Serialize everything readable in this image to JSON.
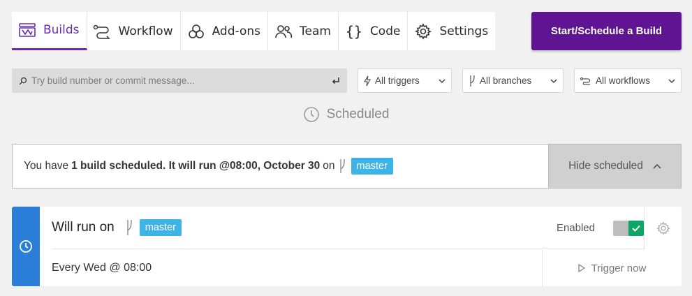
{
  "tabs": [
    {
      "label": "Builds",
      "icon": "builds-icon",
      "active": true
    },
    {
      "label": "Workflow",
      "icon": "workflow-icon"
    },
    {
      "label": "Add-ons",
      "icon": "addons-icon"
    },
    {
      "label": "Team",
      "icon": "team-icon"
    },
    {
      "label": "Code",
      "icon": "code-braces-icon"
    },
    {
      "label": "Settings",
      "icon": "gear-icon"
    }
  ],
  "start_button": "Start/Schedule a Build",
  "search": {
    "placeholder": "Try build number or commit message...",
    "value": ""
  },
  "filters": {
    "triggers": "All triggers",
    "branches": "All branches",
    "workflows": "All workflows"
  },
  "scheduled_heading": "Scheduled",
  "banner": {
    "prefix": "You have",
    "bold": "1 build scheduled. It will run @08:00, October 30",
    "on": "on",
    "branch": "master",
    "hide_label": "Hide scheduled"
  },
  "schedule_card": {
    "title": "Will run on",
    "branch": "master",
    "enabled_label": "Enabled",
    "enabled": true,
    "recurrence": "Every Wed @ 08:00",
    "trigger_label": "Trigger now"
  },
  "colors": {
    "accent": "#6a2ab5",
    "primary_button": "#5f1591",
    "branch_tag": "#3db4e5",
    "card_side": "#2b7fd8",
    "toggle_on": "#0fa566"
  }
}
